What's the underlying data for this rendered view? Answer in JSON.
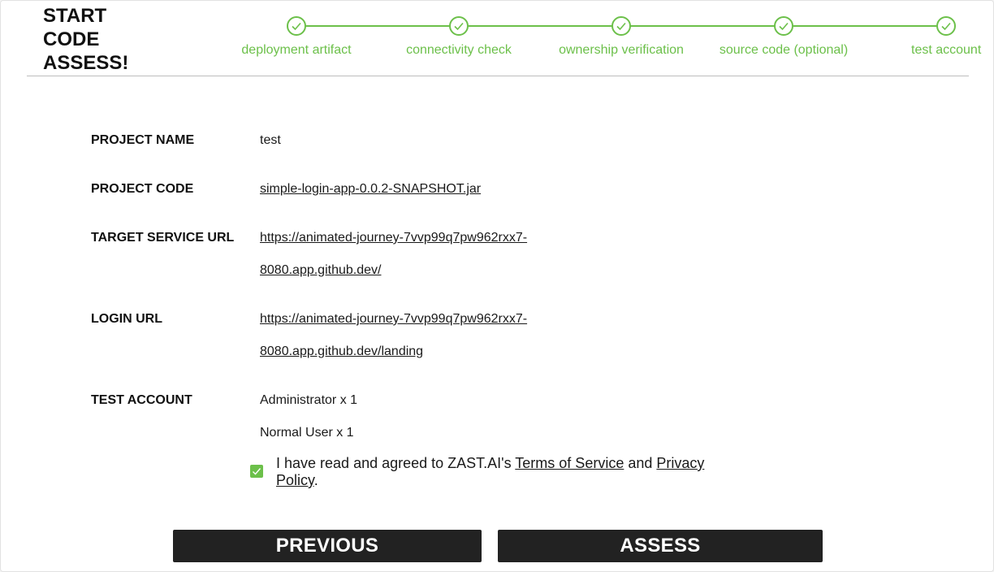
{
  "header": {
    "title": "START\nCODE\nASSESS!"
  },
  "stepper": {
    "steps": [
      {
        "label": "deployment artifact",
        "status": "complete"
      },
      {
        "label": "connectivity check",
        "status": "complete"
      },
      {
        "label": "ownership verification",
        "status": "complete"
      },
      {
        "label": "source code (optional)",
        "status": "complete"
      },
      {
        "label": "test account",
        "status": "complete"
      }
    ]
  },
  "summary": {
    "project_name": {
      "label": "PROJECT NAME",
      "value": "test"
    },
    "project_code": {
      "label": "PROJECT CODE",
      "value": "simple-login-app-0.0.2-SNAPSHOT.jar"
    },
    "target_service_url": {
      "label": "TARGET SERVICE URL",
      "line1": "https://animated-journey-7vvp99q7pw962rxx7-",
      "line2": "8080.app.github.dev/"
    },
    "login_url": {
      "label": "LOGIN URL",
      "line1": "https://animated-journey-7vvp99q7pw962rxx7-",
      "line2": "8080.app.github.dev/landing"
    },
    "test_account": {
      "label": "TEST ACCOUNT",
      "entries": [
        "Administrator x 1",
        "Normal User x 1"
      ]
    }
  },
  "agreement": {
    "checked": true,
    "prefix": "I have read and agreed to ZAST.AI's ",
    "terms_link": "Terms of Service",
    "middle": " and ",
    "privacy_link": "Privacy Policy",
    "suffix": "."
  },
  "buttons": {
    "previous": "PREVIOUS",
    "assess": "ASSESS"
  },
  "colors": {
    "accent": "#6cc04a",
    "button_bg": "#222222"
  }
}
